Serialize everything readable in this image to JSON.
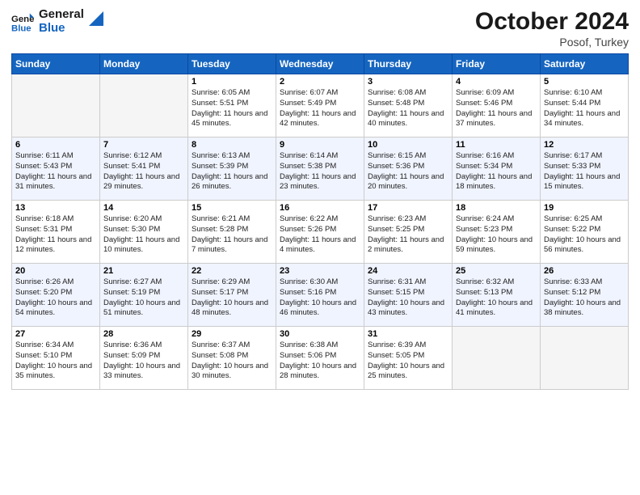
{
  "header": {
    "logo_line1": "General",
    "logo_line2": "Blue",
    "month": "October 2024",
    "location": "Posof, Turkey"
  },
  "weekdays": [
    "Sunday",
    "Monday",
    "Tuesday",
    "Wednesday",
    "Thursday",
    "Friday",
    "Saturday"
  ],
  "weeks": [
    [
      {
        "day": "",
        "info": ""
      },
      {
        "day": "",
        "info": ""
      },
      {
        "day": "1",
        "info": "Sunrise: 6:05 AM\nSunset: 5:51 PM\nDaylight: 11 hours and 45 minutes."
      },
      {
        "day": "2",
        "info": "Sunrise: 6:07 AM\nSunset: 5:49 PM\nDaylight: 11 hours and 42 minutes."
      },
      {
        "day": "3",
        "info": "Sunrise: 6:08 AM\nSunset: 5:48 PM\nDaylight: 11 hours and 40 minutes."
      },
      {
        "day": "4",
        "info": "Sunrise: 6:09 AM\nSunset: 5:46 PM\nDaylight: 11 hours and 37 minutes."
      },
      {
        "day": "5",
        "info": "Sunrise: 6:10 AM\nSunset: 5:44 PM\nDaylight: 11 hours and 34 minutes."
      }
    ],
    [
      {
        "day": "6",
        "info": "Sunrise: 6:11 AM\nSunset: 5:43 PM\nDaylight: 11 hours and 31 minutes."
      },
      {
        "day": "7",
        "info": "Sunrise: 6:12 AM\nSunset: 5:41 PM\nDaylight: 11 hours and 29 minutes."
      },
      {
        "day": "8",
        "info": "Sunrise: 6:13 AM\nSunset: 5:39 PM\nDaylight: 11 hours and 26 minutes."
      },
      {
        "day": "9",
        "info": "Sunrise: 6:14 AM\nSunset: 5:38 PM\nDaylight: 11 hours and 23 minutes."
      },
      {
        "day": "10",
        "info": "Sunrise: 6:15 AM\nSunset: 5:36 PM\nDaylight: 11 hours and 20 minutes."
      },
      {
        "day": "11",
        "info": "Sunrise: 6:16 AM\nSunset: 5:34 PM\nDaylight: 11 hours and 18 minutes."
      },
      {
        "day": "12",
        "info": "Sunrise: 6:17 AM\nSunset: 5:33 PM\nDaylight: 11 hours and 15 minutes."
      }
    ],
    [
      {
        "day": "13",
        "info": "Sunrise: 6:18 AM\nSunset: 5:31 PM\nDaylight: 11 hours and 12 minutes."
      },
      {
        "day": "14",
        "info": "Sunrise: 6:20 AM\nSunset: 5:30 PM\nDaylight: 11 hours and 10 minutes."
      },
      {
        "day": "15",
        "info": "Sunrise: 6:21 AM\nSunset: 5:28 PM\nDaylight: 11 hours and 7 minutes."
      },
      {
        "day": "16",
        "info": "Sunrise: 6:22 AM\nSunset: 5:26 PM\nDaylight: 11 hours and 4 minutes."
      },
      {
        "day": "17",
        "info": "Sunrise: 6:23 AM\nSunset: 5:25 PM\nDaylight: 11 hours and 2 minutes."
      },
      {
        "day": "18",
        "info": "Sunrise: 6:24 AM\nSunset: 5:23 PM\nDaylight: 10 hours and 59 minutes."
      },
      {
        "day": "19",
        "info": "Sunrise: 6:25 AM\nSunset: 5:22 PM\nDaylight: 10 hours and 56 minutes."
      }
    ],
    [
      {
        "day": "20",
        "info": "Sunrise: 6:26 AM\nSunset: 5:20 PM\nDaylight: 10 hours and 54 minutes."
      },
      {
        "day": "21",
        "info": "Sunrise: 6:27 AM\nSunset: 5:19 PM\nDaylight: 10 hours and 51 minutes."
      },
      {
        "day": "22",
        "info": "Sunrise: 6:29 AM\nSunset: 5:17 PM\nDaylight: 10 hours and 48 minutes."
      },
      {
        "day": "23",
        "info": "Sunrise: 6:30 AM\nSunset: 5:16 PM\nDaylight: 10 hours and 46 minutes."
      },
      {
        "day": "24",
        "info": "Sunrise: 6:31 AM\nSunset: 5:15 PM\nDaylight: 10 hours and 43 minutes."
      },
      {
        "day": "25",
        "info": "Sunrise: 6:32 AM\nSunset: 5:13 PM\nDaylight: 10 hours and 41 minutes."
      },
      {
        "day": "26",
        "info": "Sunrise: 6:33 AM\nSunset: 5:12 PM\nDaylight: 10 hours and 38 minutes."
      }
    ],
    [
      {
        "day": "27",
        "info": "Sunrise: 6:34 AM\nSunset: 5:10 PM\nDaylight: 10 hours and 35 minutes."
      },
      {
        "day": "28",
        "info": "Sunrise: 6:36 AM\nSunset: 5:09 PM\nDaylight: 10 hours and 33 minutes."
      },
      {
        "day": "29",
        "info": "Sunrise: 6:37 AM\nSunset: 5:08 PM\nDaylight: 10 hours and 30 minutes."
      },
      {
        "day": "30",
        "info": "Sunrise: 6:38 AM\nSunset: 5:06 PM\nDaylight: 10 hours and 28 minutes."
      },
      {
        "day": "31",
        "info": "Sunrise: 6:39 AM\nSunset: 5:05 PM\nDaylight: 10 hours and 25 minutes."
      },
      {
        "day": "",
        "info": ""
      },
      {
        "day": "",
        "info": ""
      }
    ]
  ]
}
